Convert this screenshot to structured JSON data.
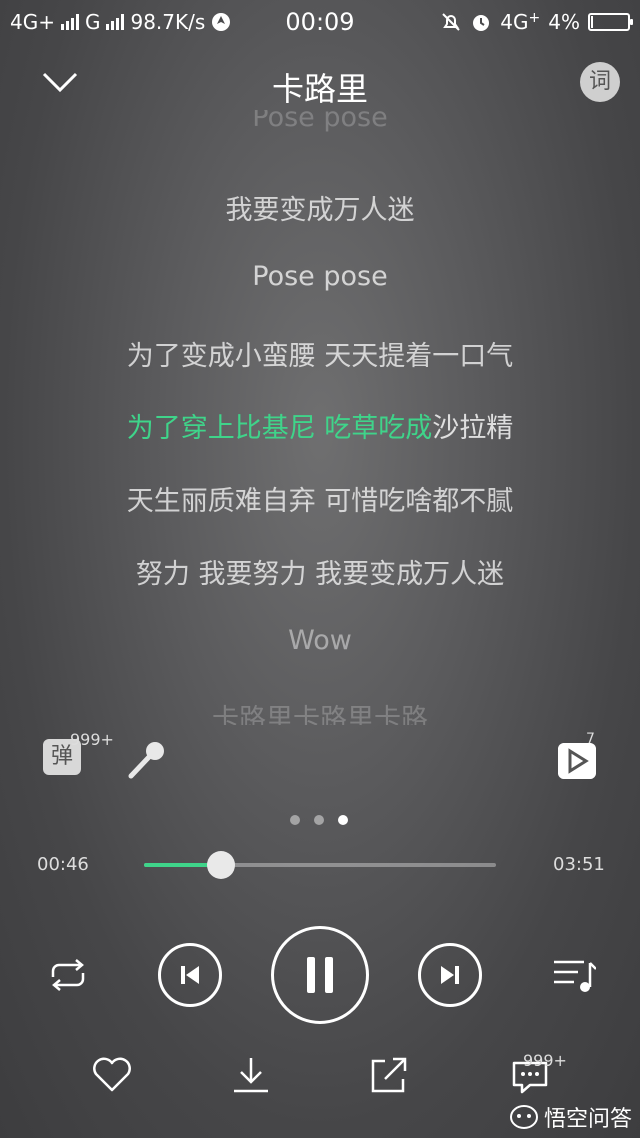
{
  "status_bar": {
    "network1": "4G+",
    "network2": "G",
    "speed": "98.7K/s",
    "time": "00:09",
    "network3": "4G",
    "battery": "4%"
  },
  "header": {
    "title": "卡路里",
    "lyric_button_label": "词"
  },
  "lyrics": {
    "lines": [
      "Pose pose",
      "我要变成万人迷",
      "Pose pose",
      "为了变成小蛮腰 天天提着一口气",
      "",
      "天生丽质难自弃 可惜吃啥都不腻",
      "努力 我要努力 我要变成万人迷",
      "Wow",
      "卡路里卡路里卡路"
    ],
    "current_played": "为了穿上比基尼 吃草吃成",
    "current_rest": "沙拉精"
  },
  "actions": {
    "danmaku_label": "弹",
    "danmaku_count": "999+",
    "video_count": "7"
  },
  "pager": {
    "count": 3,
    "active": 2
  },
  "progress": {
    "current": "00:46",
    "total": "03:51",
    "fraction": 0.22
  },
  "bottom": {
    "comment_count": "999+",
    "watermark": "悟空问答"
  },
  "colors": {
    "accent": "#3fd48a"
  }
}
